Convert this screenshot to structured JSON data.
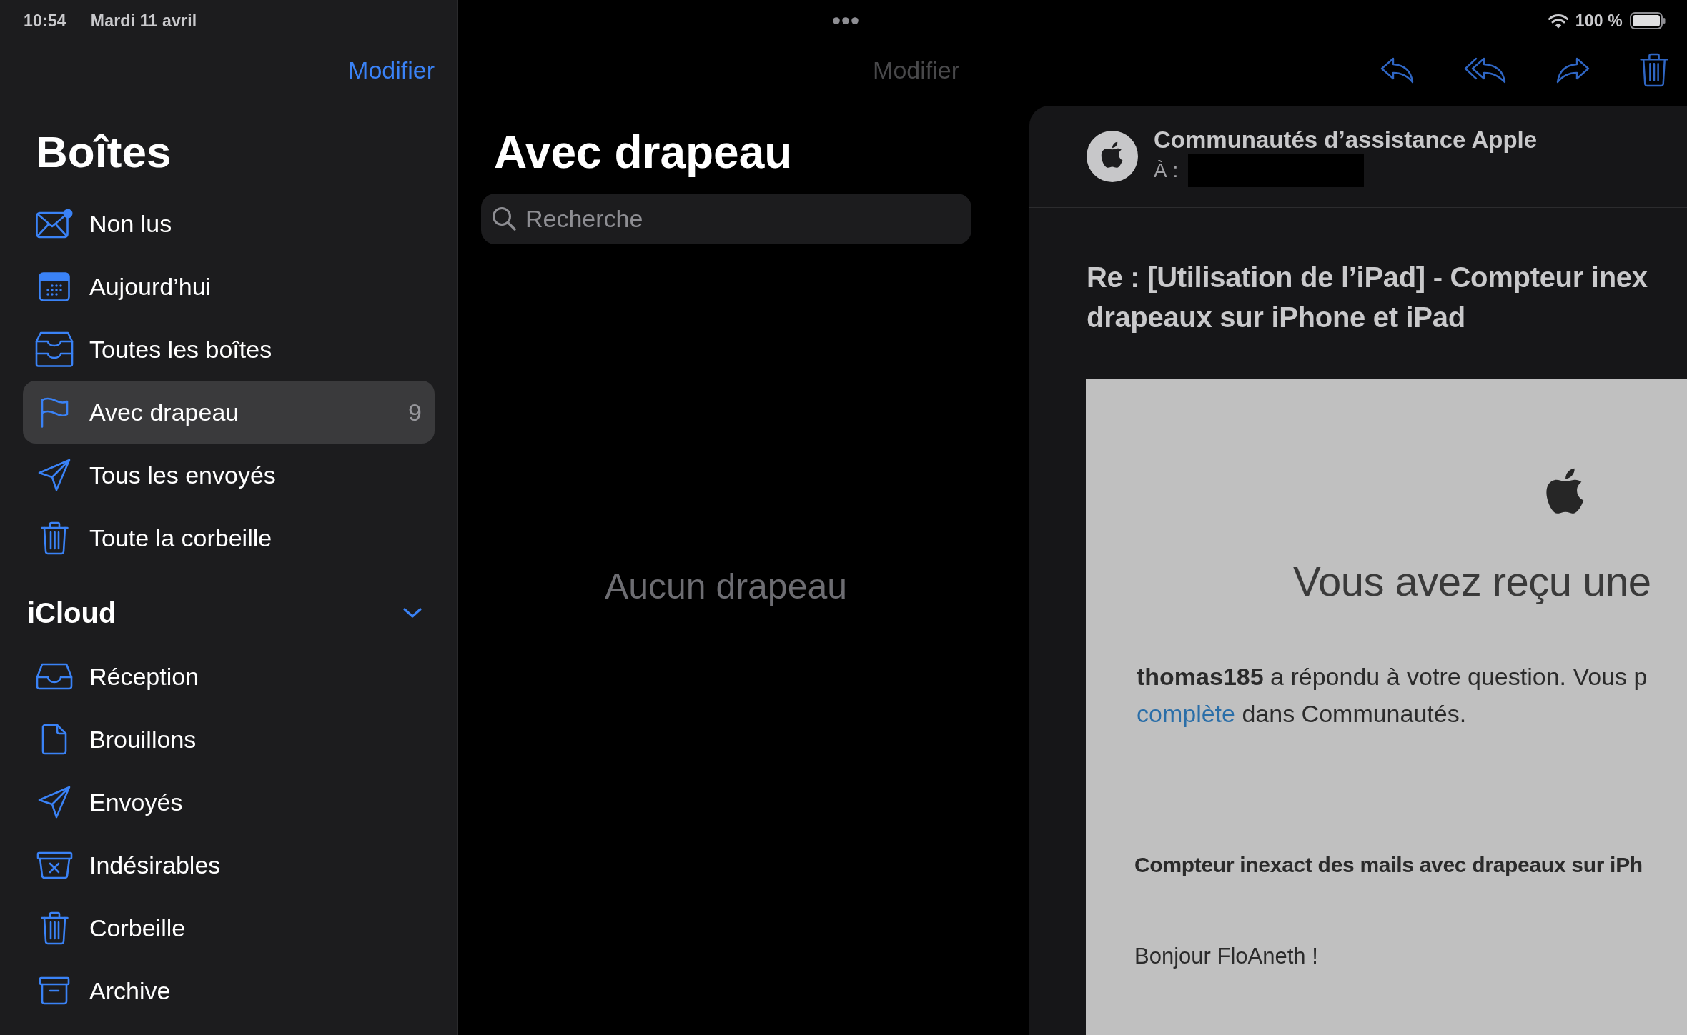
{
  "status_bar": {
    "time": "10:54",
    "date": "Mardi 11 avril",
    "battery": "100 %"
  },
  "sidebar": {
    "edit_button": {
      "label": "Modifier",
      "disabled": false
    },
    "title": "Boîtes",
    "mailboxes": [
      {
        "kind": "unread",
        "label": "Non lus",
        "selected": false
      },
      {
        "kind": "today",
        "label": "Aujourd’hui",
        "selected": false
      },
      {
        "kind": "all_inboxes",
        "label": "Toutes les boîtes",
        "selected": false
      },
      {
        "kind": "flagged",
        "label": "Avec drapeau",
        "count": "9",
        "selected": true
      },
      {
        "kind": "sent",
        "label": "Tous les envoyés",
        "selected": false
      },
      {
        "kind": "trash",
        "label": "Toute la corbeille",
        "selected": false
      }
    ],
    "accounts": [
      {
        "title": "iCloud",
        "expanded": true,
        "mailboxes": [
          {
            "kind": "inbox",
            "label": "Réception",
            "selected": false
          },
          {
            "kind": "drafts",
            "label": "Brouillons",
            "selected": false
          },
          {
            "kind": "sent",
            "label": "Envoyés",
            "selected": false
          },
          {
            "kind": "junk",
            "label": "Indésirables",
            "selected": false
          },
          {
            "kind": "trash",
            "label": "Corbeille",
            "selected": false
          },
          {
            "kind": "archive",
            "label": "Archive",
            "selected": false
          }
        ]
      }
    ]
  },
  "message_list": {
    "edit_button": {
      "label": "Modifier",
      "disabled": true
    },
    "title": "Avec drapeau",
    "search": {
      "placeholder": "Recherche"
    },
    "empty_text": "Aucun drapeau"
  },
  "message": {
    "sender": "Communautés d’assistance Apple",
    "to_label": "À :",
    "subject_lines": [
      "Re : [Utilisation de l’iPad] - Compteur inex",
      "drapeaux sur iPhone et iPad"
    ],
    "body": {
      "heading": "Vous avez reçu une",
      "notice": {
        "line_1": "**thomas185** a répondu à votre question. Vous p",
        "link": "complète",
        "line_2": "dans Communautés."
      },
      "topic": "Compteur inexact des mails avec drapeaux sur iPh",
      "greeting": "Bonjour FloAneth !"
    }
  }
}
